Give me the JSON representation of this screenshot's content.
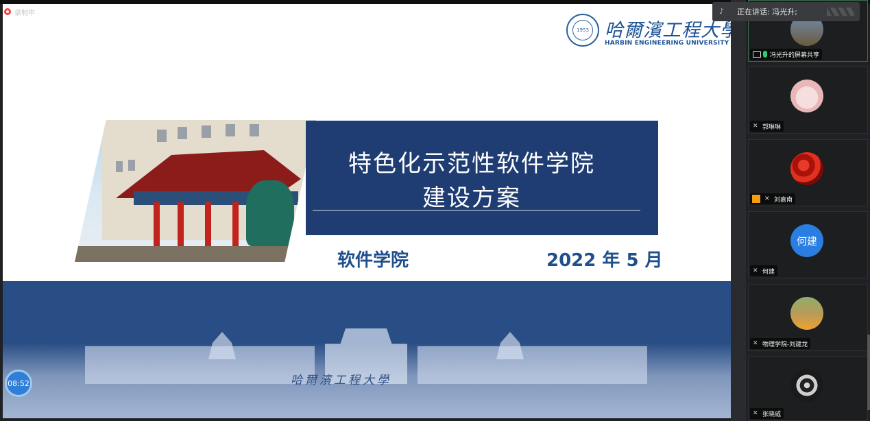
{
  "recording": {
    "label": "录制中"
  },
  "slide": {
    "logo_cn": "哈爾濱工程大學",
    "logo_en": "HARBIN ENGINEERING UNIVERSITY",
    "seal_text": "1953",
    "title_line1": "特色化示范性软件学院",
    "title_line2": "建设方案",
    "school": "软件学院",
    "date": "2022 年 5 月",
    "banner_script": "哈爾濱工程大學"
  },
  "timer": {
    "value": "08:52"
  },
  "speaking": {
    "label": "正在讲话: 冯光升;"
  },
  "participants": [
    {
      "name": "冯光升的屏幕共享",
      "icon": "screen-share-icon"
    },
    {
      "name": "郭琳琳",
      "icon": "mic-muted-icon"
    },
    {
      "name": "刘嘉南",
      "icon": "mic-muted-icon"
    },
    {
      "name": "何建",
      "icon": "mic-muted-icon",
      "avatar_text": "何建"
    },
    {
      "name": "物理学院-刘建龙",
      "icon": "mic-muted-icon"
    },
    {
      "name": "张晓威",
      "icon": "mic-muted-icon"
    }
  ]
}
